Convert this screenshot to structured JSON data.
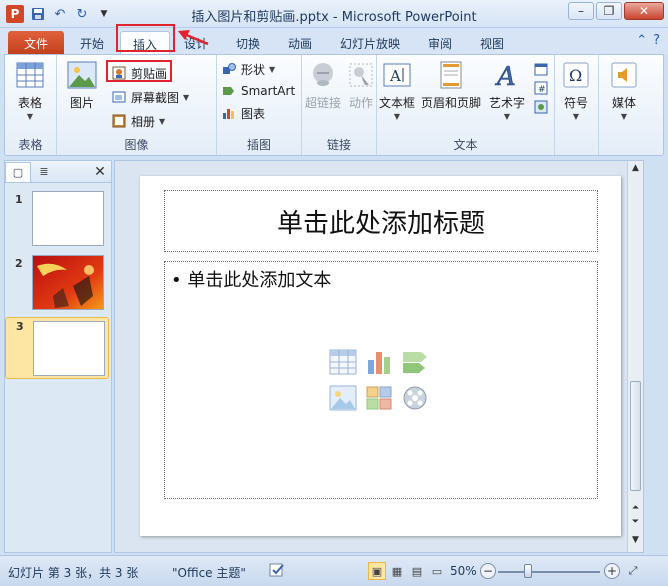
{
  "window": {
    "title": "插入图片和剪贴画.pptx - Microsoft PowerPoint",
    "app_icon": "P"
  },
  "ribbon_tabs": [
    {
      "label": "文件"
    },
    {
      "label": "开始"
    },
    {
      "label": "插入"
    },
    {
      "label": "设计"
    },
    {
      "label": "切换"
    },
    {
      "label": "动画"
    },
    {
      "label": "幻灯片放映"
    },
    {
      "label": "审阅"
    },
    {
      "label": "视图"
    }
  ],
  "active_tab": "插入",
  "ribbon": {
    "tables": {
      "label": "表格",
      "table_btn": "表格"
    },
    "images": {
      "label": "图像",
      "picture_btn": "图片",
      "clipart_btn": "剪贴画",
      "screenshot_btn": "屏幕截图",
      "album_btn": "相册"
    },
    "illustrations": {
      "label": "插图",
      "shapes_btn": "形状",
      "smartart_btn": "SmartArt",
      "chart_btn": "图表"
    },
    "links": {
      "label": "链接",
      "hyperlink_btn": "超链接",
      "action_btn": "动作"
    },
    "text": {
      "label": "文本",
      "textbox_btn": "文本框",
      "header_footer_btn": "页眉和页脚",
      "wordart_btn": "艺术字"
    },
    "symbols": {
      "symbol_btn": "符号"
    },
    "media": {
      "media_btn": "媒体"
    }
  },
  "slides_pane": {
    "slides": [
      {
        "number": "1"
      },
      {
        "number": "2"
      },
      {
        "number": "3"
      }
    ],
    "selected_slide": "3"
  },
  "slide": {
    "title_placeholder": "单击此处添加标题",
    "body_placeholder": "单击此处添加文本"
  },
  "statusbar": {
    "slide_info": "幻灯片 第 3 张，共 3 张",
    "theme": "\"Office 主题\"",
    "zoom": "50%"
  },
  "colors": {
    "file_tab": "#c3401c",
    "highlight": "#e0232e",
    "selected_thumb": "#fde6a4"
  }
}
